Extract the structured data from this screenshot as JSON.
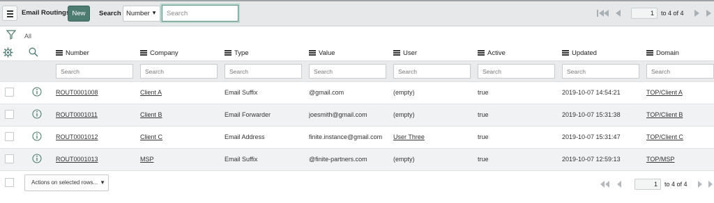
{
  "toolbar": {
    "title": "Email Routings",
    "new_label": "New",
    "search_label": "Search",
    "search_field_selected": "Number",
    "search_placeholder": "Search",
    "page_value": "1",
    "page_count": "to 4 of 4"
  },
  "filter": {
    "label": "All"
  },
  "columns": [
    {
      "key": "number",
      "label": "Number"
    },
    {
      "key": "company",
      "label": "Company"
    },
    {
      "key": "type",
      "label": "Type"
    },
    {
      "key": "value",
      "label": "Value"
    },
    {
      "key": "user",
      "label": "User"
    },
    {
      "key": "active",
      "label": "Active"
    },
    {
      "key": "updated",
      "label": "Updated"
    },
    {
      "key": "domain",
      "label": "Domain"
    }
  ],
  "column_search_placeholder": "Search",
  "rows": [
    {
      "number": "ROUT0001008",
      "company": "Client A",
      "type": "Email Suffix",
      "value": "@gmail.com",
      "user": "(empty)",
      "active": "true",
      "updated": "2019-10-07 14:54:21",
      "domain": "TOP/Client A"
    },
    {
      "number": "ROUT0001011",
      "company": "Client B",
      "type": "Email Forwarder",
      "value": "joesmith@gmail.com",
      "user": "(empty)",
      "active": "true",
      "updated": "2019-10-07 15:31:38",
      "domain": "TOP/Client B"
    },
    {
      "number": "ROUT0001012",
      "company": "Client C",
      "type": "Email Address",
      "value": "finite.instance@gmail.com",
      "user": "User Three",
      "active": "true",
      "updated": "2019-10-07 15:31:47",
      "domain": "TOP/Client C"
    },
    {
      "number": "ROUT0001013",
      "company": "MSP",
      "type": "Email Suffix",
      "value": "@finite-partners.com",
      "user": "(empty)",
      "active": "true",
      "updated": "2019-10-07 12:59:13",
      "domain": "TOP/MSP"
    }
  ],
  "footer": {
    "actions_label": "Actions on selected rows...",
    "page_value": "1",
    "page_count": "to 4 of 4"
  },
  "colors": {
    "accent": "#4d7b6f",
    "header_bg": "#e6e8ea",
    "alt_row": "#f1f2f3"
  }
}
